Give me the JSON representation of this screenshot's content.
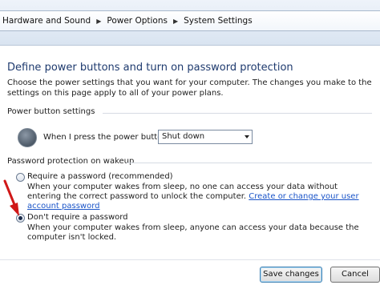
{
  "breadcrumb": {
    "items": [
      "Hardware and Sound",
      "Power Options",
      "System Settings"
    ],
    "separator": "▶"
  },
  "page": {
    "title": "Define power buttons and turn on password protection",
    "intro": "Choose the power settings that you want for your computer. The changes you make to the settings on this page apply to all of your power plans."
  },
  "power_buttons": {
    "header": "Power button settings",
    "label": "When I press the power button:",
    "selected": "Shut down",
    "icon": "power-icon"
  },
  "wakeup": {
    "header": "Password protection on wakeup",
    "require": {
      "label": "Require a password (recommended)",
      "desc": "When your computer wakes from sleep, no one can access your data without entering the correct password to unlock the computer.",
      "link": "Create or change your user account password",
      "selected": false
    },
    "dont_require": {
      "label": "Don't require a password",
      "desc": "When your computer wakes from sleep, anyone can access your data because the computer isn't locked.",
      "selected": true
    }
  },
  "footer": {
    "save_label": "Save changes",
    "cancel_label": "Cancel"
  },
  "colors": {
    "title": "#1e3a6e",
    "link": "#1a54c8",
    "annotation_arrow": "#d01818"
  }
}
